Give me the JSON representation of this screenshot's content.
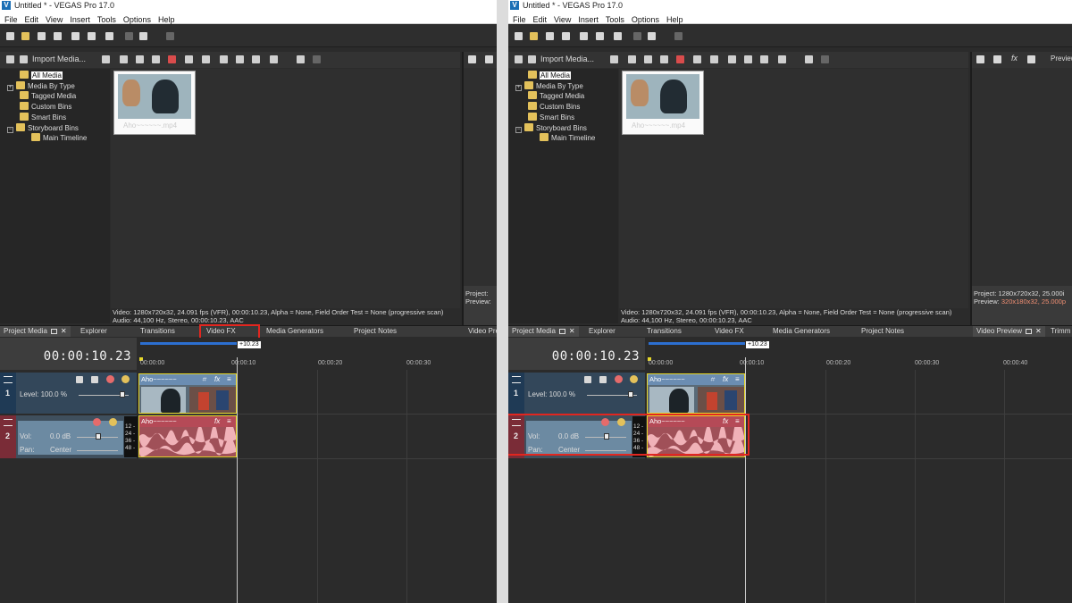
{
  "app": {
    "title": "Untitled * - VEGAS Pro 17.0",
    "logo_text": "V"
  },
  "menus": [
    "File",
    "Edit",
    "View",
    "Insert",
    "Tools",
    "Options",
    "Help"
  ],
  "project_media": {
    "import_label": "Import Media...",
    "tree": [
      {
        "label": "All Media",
        "selected": true,
        "expandable": false
      },
      {
        "label": "Media By Type",
        "expandable": true
      },
      {
        "label": "Tagged Media"
      },
      {
        "label": "Custom Bins"
      },
      {
        "label": "Smart Bins"
      },
      {
        "label": "Storyboard Bins",
        "expandable": true
      },
      {
        "label": "Main Timeline",
        "child": true
      }
    ],
    "media_file": "Aho~~~~~~.mp4",
    "info_video": "Video: 1280x720x32, 24.091 fps (VFR), 00:00:10.23, Alpha = None, Field Order Test = None (progressive scan)",
    "info_audio": "Audio: 44,100 Hz, Stereo, 00:00:10.23, AAC"
  },
  "preview_panel": {
    "right_label": "Preview",
    "project_line": "Project:  1280x720x32, 25.000i",
    "preview_label": "Preview:",
    "preview_value": "320x180x32, 25.000p",
    "left_project": "Project:",
    "left_preview": "Preview:"
  },
  "tabs_left": [
    "Project Media",
    "Explorer",
    "Transitions",
    "Video FX",
    "Media Generators",
    "Project Notes",
    "Video Pre"
  ],
  "tabs_right": [
    "Project Media",
    "Explorer",
    "Transitions",
    "Video FX",
    "Media Generators",
    "Project Notes",
    "Video Preview",
    "Trimm"
  ],
  "timeline": {
    "timecode": "00:00:10.23",
    "marker": "+10.23",
    "ticks": [
      "00:00:00",
      "00:00:10",
      "00:00:20",
      "00:00:30",
      "00:00:40"
    ],
    "video_track": {
      "number": "1",
      "level_label": "Level: 100.0 %"
    },
    "audio_track": {
      "number": "2",
      "vol_label": "Vol:",
      "vol_value": "0.0 dB",
      "pan_label": "Pan:",
      "pan_value": "Center"
    },
    "meter_labels": [
      "12 -",
      "24 -",
      "36 -",
      "48 -"
    ],
    "clip_name": "Aho~~~~~~",
    "fx_label": "fx"
  },
  "colors": {
    "highlight": "#e2261f",
    "clip_border": "#e5d72a",
    "video_clip": "#6b8db2",
    "audio_clip": "#b54a57"
  }
}
